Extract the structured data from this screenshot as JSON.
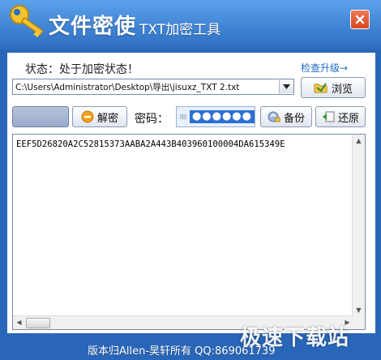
{
  "window": {
    "title": "文件密使",
    "subtitle": "TXT加密工具",
    "close_icon": "close-icon",
    "colors": {
      "title_bar": "#2e6ec2",
      "accent": "#1c6bc4",
      "close": "#d8461f"
    }
  },
  "status": {
    "label": "状态：处于加密状态！",
    "update_link": "检查升级→"
  },
  "file": {
    "path": "C:\\Users\\Administrator\\Desktop\\导出\\jisuxz_TXT 2.txt",
    "browse_label": "浏览"
  },
  "actions": {
    "decrypt_label": "解密",
    "password_label": "密码：",
    "password_mask": "●●●●●●",
    "backup_label": "备份",
    "restore_label": "还原"
  },
  "content": {
    "text": "EEF5D26820A2C52815373AABA2A443B403960100004DA615349E"
  },
  "footer": {
    "copyright": "版本归Allen-昊轩所有  QQ:869061739",
    "watermark": "极速下载站"
  }
}
